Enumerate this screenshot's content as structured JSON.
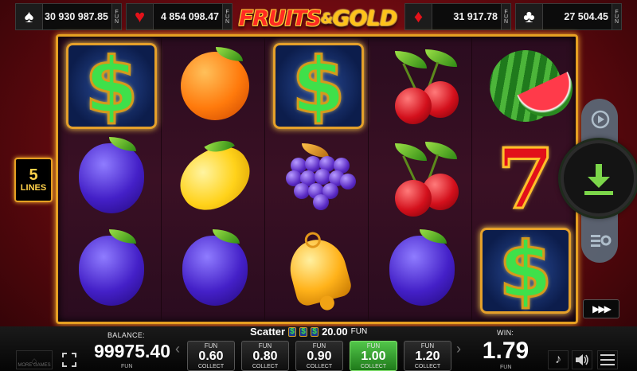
{
  "jackpots": [
    {
      "suit": "spade-icon",
      "symbol": "♠",
      "color": "#ffffff",
      "value": "30 930 987.85",
      "currency": "FUN"
    },
    {
      "suit": "heart-icon",
      "symbol": "♥",
      "color": "#e3121a",
      "value": "4 854 098.47",
      "currency": "FUN"
    },
    {
      "suit": "diamond-icon",
      "symbol": "♦",
      "color": "#e3121a",
      "value": "31 917.78",
      "currency": "FUN"
    },
    {
      "suit": "club-icon",
      "symbol": "♣",
      "color": "#ffffff",
      "value": "27 504.45",
      "currency": "FUN"
    }
  ],
  "logo": {
    "part1": "FRUITS",
    "amp": "&",
    "part2": "GOLD"
  },
  "lines": {
    "count": "5",
    "label": "LINES"
  },
  "reels": [
    [
      "dollar-scatter",
      "plum",
      "plum"
    ],
    [
      "orange",
      "lemon",
      "plum"
    ],
    [
      "dollar-scatter",
      "grapes",
      "bell"
    ],
    [
      "cherries",
      "cherries",
      "plum"
    ],
    [
      "watermelon",
      "seven",
      "dollar-scatter"
    ]
  ],
  "symbols": {
    "dollar": "$",
    "seven": "7"
  },
  "balance": {
    "label": "BALANCE:",
    "value": "99975.40",
    "currency": "FUN"
  },
  "scatter": {
    "label": "Scatter",
    "value": "20.00",
    "currency": "FUN"
  },
  "bets": [
    {
      "currency": "FUN",
      "value": "0.60",
      "action": "COLLECT",
      "active": false
    },
    {
      "currency": "FUN",
      "value": "0.80",
      "action": "COLLECT",
      "active": false
    },
    {
      "currency": "FUN",
      "value": "0.90",
      "action": "COLLECT",
      "active": false
    },
    {
      "currency": "FUN",
      "value": "1.00",
      "action": "COLLECT",
      "active": true
    },
    {
      "currency": "FUN",
      "value": "1.20",
      "action": "COLLECT",
      "active": false
    }
  ],
  "win": {
    "label": "WIN:",
    "value": "1.79",
    "currency": "FUN"
  },
  "more_games": {
    "label": "MORE GAMES"
  },
  "colors": {
    "frame": "#e6a022",
    "active_bet": "#3aa832",
    "background": "#8e0f16"
  }
}
